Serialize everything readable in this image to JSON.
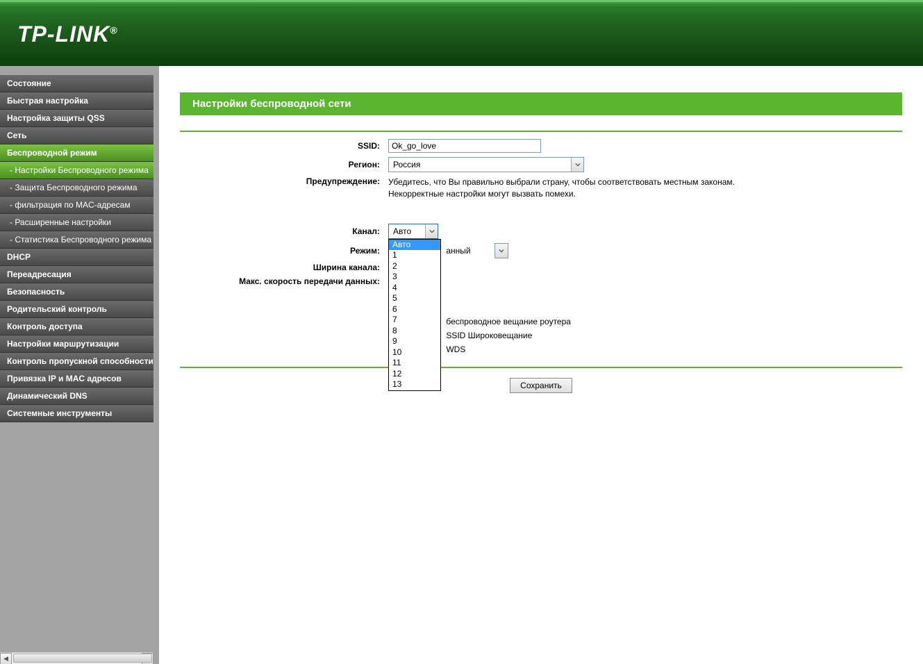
{
  "brand": "TP-LINK",
  "sidebar": {
    "items": [
      {
        "label": "Состояние",
        "type": "main"
      },
      {
        "label": "Быстрая настройка",
        "type": "main"
      },
      {
        "label": "Настройка защиты QSS",
        "type": "main"
      },
      {
        "label": "Сеть",
        "type": "main"
      },
      {
        "label": "Беспроводной режим",
        "type": "main",
        "active": true
      },
      {
        "label": "- Настройки Беспроводного режима",
        "type": "sub",
        "active": true
      },
      {
        "label": "- Защита Беспроводного режима",
        "type": "sub"
      },
      {
        "label": "- фильтрация по MAC-адресам",
        "type": "sub"
      },
      {
        "label": "- Расширенные настройки",
        "type": "sub"
      },
      {
        "label": "- Статистика Беспроводного режима",
        "type": "sub"
      },
      {
        "label": "DHCP",
        "type": "main"
      },
      {
        "label": "Переадресация",
        "type": "main"
      },
      {
        "label": "Безопасность",
        "type": "main"
      },
      {
        "label": "Родительский контроль",
        "type": "main"
      },
      {
        "label": "Контроль доступа",
        "type": "main"
      },
      {
        "label": "Настройки маршрутизации",
        "type": "main"
      },
      {
        "label": "Контроль пропускной способности",
        "type": "main"
      },
      {
        "label": "Привязка IP и MAC адресов",
        "type": "main"
      },
      {
        "label": "Динамический DNS",
        "type": "main"
      },
      {
        "label": "Системные инструменты",
        "type": "main"
      }
    ]
  },
  "page": {
    "title": "Настройки беспроводной сети",
    "labels": {
      "ssid": "SSID:",
      "region": "Регион:",
      "warning": "Предупреждение:",
      "channel": "Канал:",
      "mode": "Режим:",
      "channel_width": "Ширина канала:",
      "max_speed": "Макс. скорость передачи данных:"
    },
    "values": {
      "ssid": "Ok_go_love",
      "region": "Россия",
      "channel": "Авто",
      "mode_suffix": "анный"
    },
    "warning_line1": "Убедитесь, что Вы правильно выбрали страну, чтобы соответствовать местным законам.",
    "warning_line2": "Некорректные настройки могут вызвать помехи.",
    "channel_options": [
      "Авто",
      "1",
      "2",
      "3",
      "4",
      "5",
      "6",
      "7",
      "8",
      "9",
      "10",
      "11",
      "12",
      "13"
    ],
    "checkboxes": {
      "broadcast": "беспроводное вещание роутера",
      "ssid_broadcast": "SSID Широковещание",
      "wds": "WDS"
    },
    "save_button": "Сохранить"
  }
}
